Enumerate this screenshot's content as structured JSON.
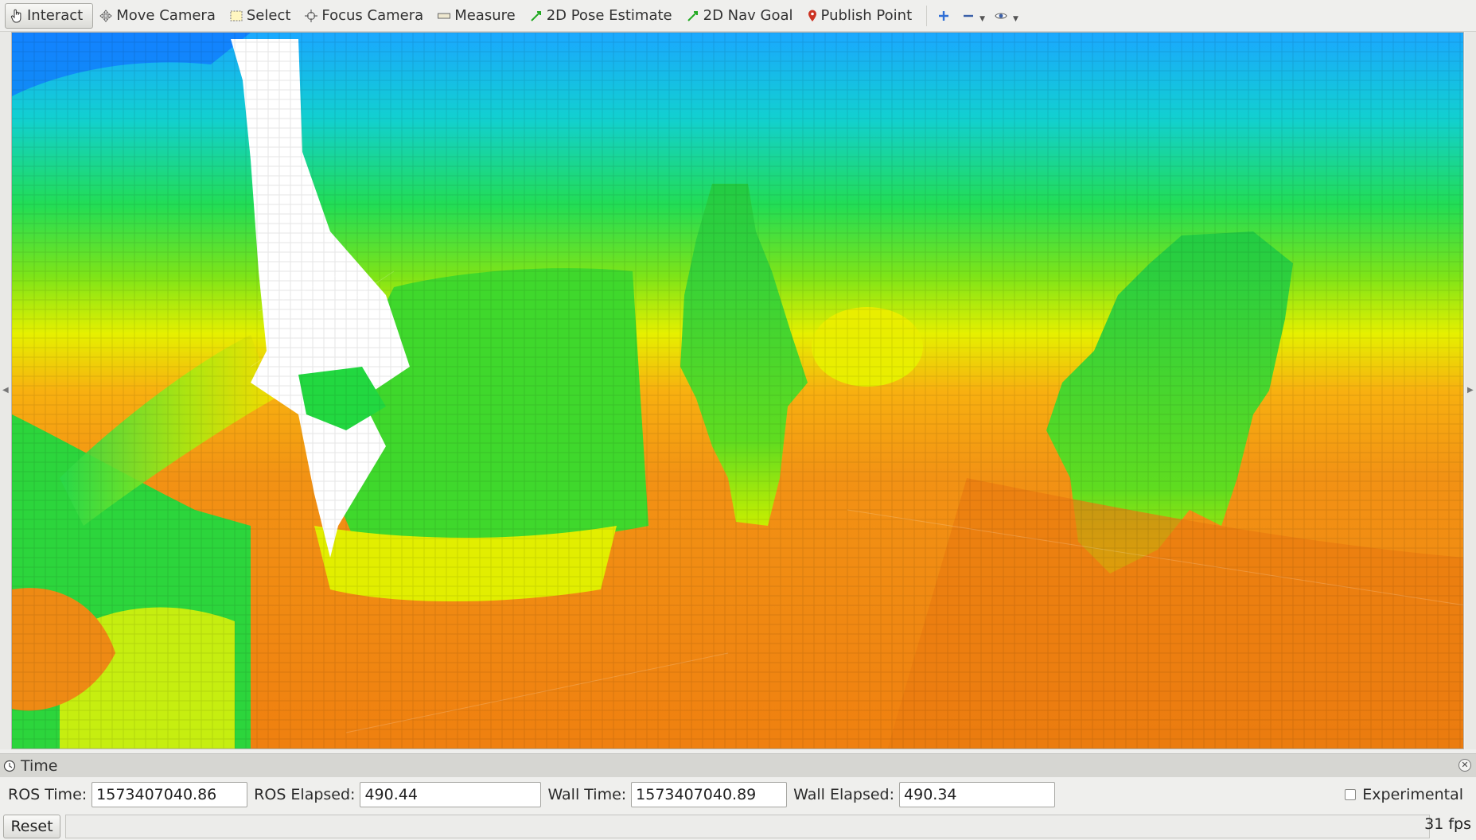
{
  "toolbar": {
    "tools": [
      {
        "label": "Interact",
        "icon": "hand-pointer-icon",
        "active": true
      },
      {
        "label": "Move Camera",
        "icon": "move-arrows-icon"
      },
      {
        "label": "Select",
        "icon": "select-rect-icon"
      },
      {
        "label": "Focus Camera",
        "icon": "crosshair-icon"
      },
      {
        "label": "Measure",
        "icon": "ruler-icon"
      },
      {
        "label": "2D Pose Estimate",
        "icon": "green-arrow-icon"
      },
      {
        "label": "2D Nav Goal",
        "icon": "green-arrow-icon"
      },
      {
        "label": "Publish Point",
        "icon": "map-pin-icon"
      }
    ],
    "extra_icons": [
      "plus-icon",
      "minus-dropdown-icon",
      "eye-dropdown-icon"
    ]
  },
  "time_panel": {
    "title": "Time",
    "ros_time_label": "ROS Time:",
    "ros_time": "1573407040.86",
    "ros_elapsed_label": "ROS Elapsed:",
    "ros_elapsed": "490.44",
    "wall_time_label": "Wall Time:",
    "wall_time": "1573407040.89",
    "wall_elapsed_label": "Wall Elapsed:",
    "wall_elapsed": "490.34",
    "experimental_label": "Experimental"
  },
  "bottom": {
    "reset_label": "Reset",
    "fps": "31 fps"
  },
  "colors": {
    "toolbar_bg": "#efefed",
    "cloud_blue": "#1e90ff",
    "cloud_green": "#2ad43a",
    "cloud_yellow": "#e6f000",
    "cloud_orange": "#f08a10",
    "pose_arrow": "#22aa22",
    "pin": "#cc3322"
  }
}
